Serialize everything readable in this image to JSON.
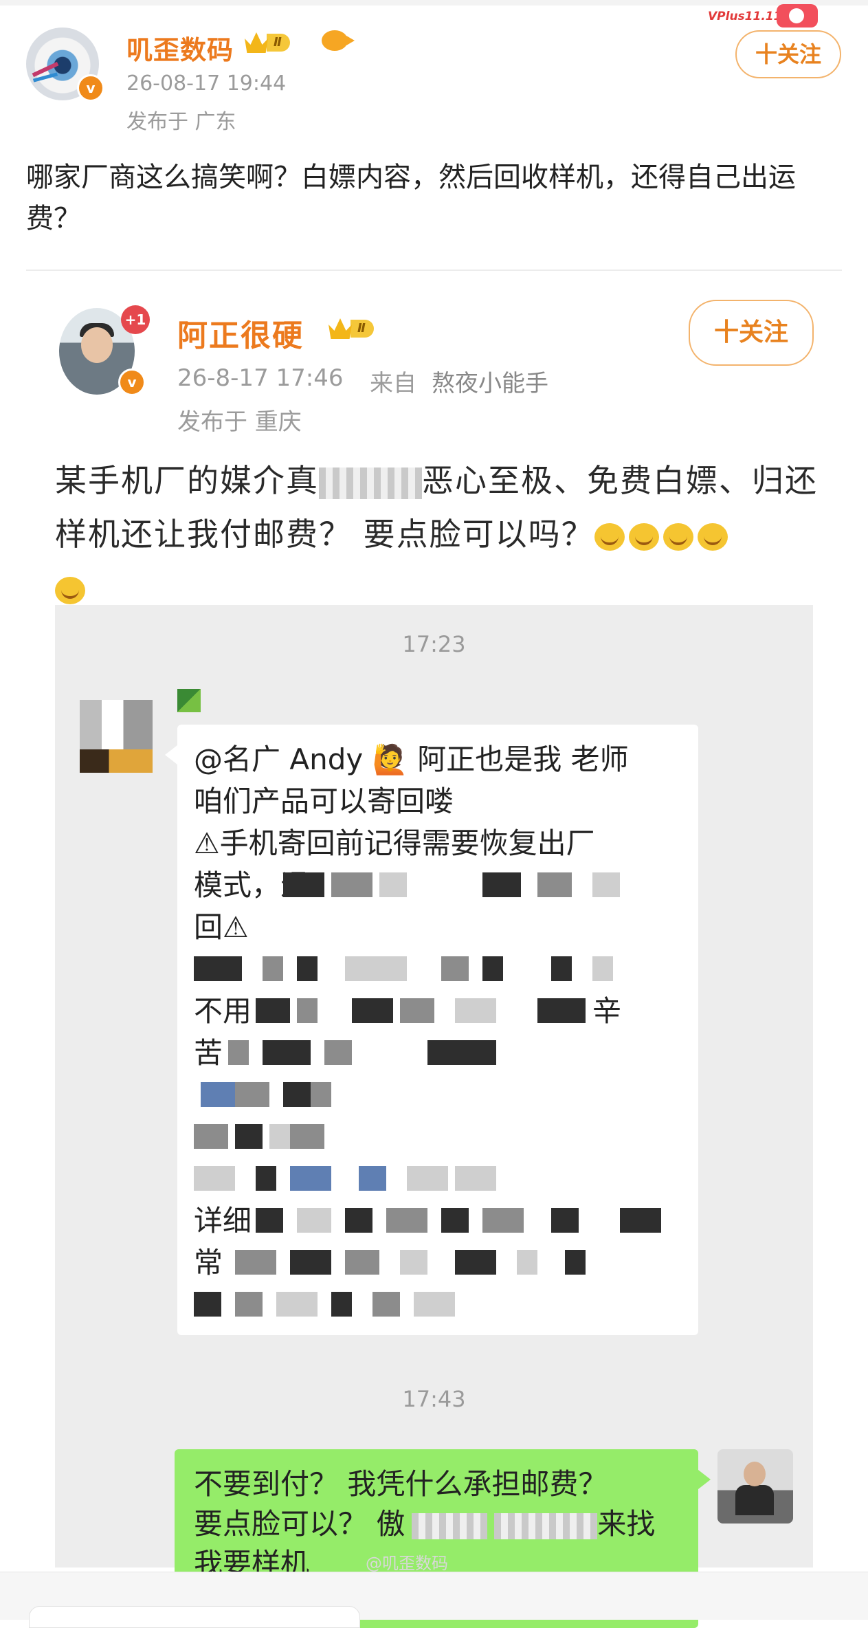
{
  "post": {
    "author": "叽歪数码",
    "level": "Ⅱ",
    "timestamp": "26-08-17 19:44",
    "location": "发布于 广东",
    "follow_label": "十关注",
    "promo": "VPlus11.11",
    "text": "哪家厂商这么搞笑啊？白嫖内容，然后回收样机，还得自己出运费？"
  },
  "repost": {
    "author": "阿正很硬",
    "level": "Ⅱ",
    "badge": "+1",
    "timestamp": "26-8-17 17:46",
    "source_prefix": "来自",
    "source": "熬夜小能手",
    "location": "发布于 重庆",
    "follow_label": "十关注",
    "text_a": "某手机厂的媒介真",
    "text_b": "恶心至极、免费白嫖、归还样机还让我付邮费？ 要点脸可以吗？"
  },
  "chat": {
    "time1": "17:23",
    "msg_lines": [
      "@名广 Andy 🙋 阿正也是我 老师",
      "咱们产品可以寄回喽",
      "⚠手机寄回前记得需要恢复出厂",
      "模式，退",
      "回⚠"
    ],
    "frag_1": "不用",
    "frag_2": "辛",
    "frag_3": "苦",
    "frag_4": "详细",
    "frag_5": "常",
    "time2": "17:43",
    "reply_line1": "不要到付？ 我凭什么承担邮费？",
    "reply_line2a": "要点脸可以？ 傲",
    "reply_line2b": "来找",
    "reply_line3": "我要样机"
  },
  "watermark": "@叽歪数码",
  "colors": {
    "name_orange": "#ec7a1e",
    "follow_border": "#f3b36c",
    "bubble_green": "#95ec69",
    "chat_bg": "#ededed",
    "verified_orange": "#f08a19"
  },
  "icons": [
    "verified-icon",
    "crown-level-icon",
    "fish-badge-icon",
    "laugh-cry-emoji",
    "warning-icon"
  ]
}
